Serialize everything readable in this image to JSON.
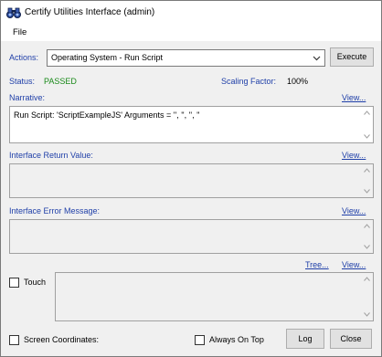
{
  "window": {
    "title": "Certify Utilities Interface (admin)"
  },
  "menu": {
    "file": "File"
  },
  "actions": {
    "label": "Actions:",
    "selected": "Operating System - Run Script",
    "execute_label": "Execute"
  },
  "status": {
    "label": "Status:",
    "value": "PASSED",
    "scaling_label": "Scaling Factor:",
    "scaling_value": "100%"
  },
  "narrative": {
    "label": "Narrative:",
    "view_label": "View...",
    "text": "Run Script: 'ScriptExampleJS' Arguments = '', '', '', ''"
  },
  "return_value": {
    "label": "Interface Return Value:",
    "view_label": "View..."
  },
  "error_message": {
    "label": "Interface Error Message:",
    "view_label": "View..."
  },
  "tree": {
    "tree_label": "Tree...",
    "view_label": "View..."
  },
  "touch": {
    "label": "Touch",
    "checked": false
  },
  "bottom": {
    "screen_coords_label": "Screen Coordinates:",
    "always_on_top_label": "Always On Top",
    "log_label": "Log",
    "close_label": "Close"
  },
  "colors": {
    "label_blue": "#1f3fa8",
    "passed_green": "#1a8a1a",
    "link_blue": "#1f3fa8"
  },
  "icons": {
    "app": "binoculars-icon",
    "combo_arrow": "chevron-down-icon",
    "scroll_up": "chevron-up-icon",
    "scroll_down": "chevron-down-icon"
  }
}
